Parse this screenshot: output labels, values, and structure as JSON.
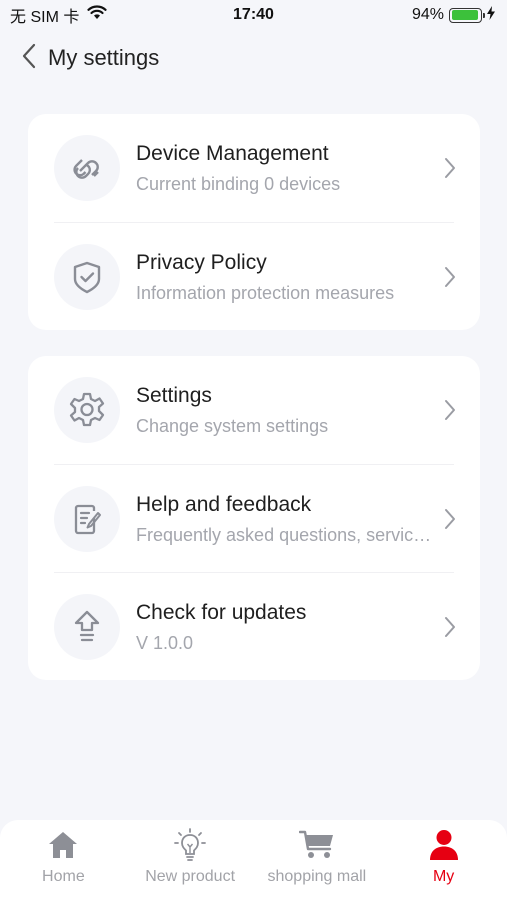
{
  "status_bar": {
    "carrier": "无 SIM 卡",
    "time": "17:40",
    "battery_percent": "94%",
    "battery_level": 0.94
  },
  "header": {
    "title": "My settings",
    "back_icon": "chevron-left-icon"
  },
  "groups": [
    {
      "items": [
        {
          "title": "Device Management",
          "subtitle": "Current binding 0 devices",
          "icon": "link-icon"
        },
        {
          "title": "Privacy Policy",
          "subtitle": "Information protection measures",
          "icon": "shield-check-icon"
        }
      ]
    },
    {
      "items": [
        {
          "title": "Settings",
          "subtitle": "Change system settings",
          "icon": "gear-icon"
        },
        {
          "title": "Help and feedback",
          "subtitle": "Frequently asked questions, service feedback",
          "icon": "edit-document-icon"
        },
        {
          "title": "Check for updates",
          "subtitle": "V 1.0.0",
          "icon": "upload-arrow-icon"
        }
      ]
    }
  ],
  "tab_bar": {
    "tabs": [
      {
        "label": "Home",
        "icon": "home-icon",
        "active": false
      },
      {
        "label": "New product",
        "icon": "lightbulb-icon",
        "active": false
      },
      {
        "label": "shopping mall",
        "icon": "cart-icon",
        "active": false
      },
      {
        "label": "My",
        "icon": "person-icon",
        "active": true
      }
    ]
  },
  "colors": {
    "accent": "#e60012",
    "background": "#f5f6fa",
    "inactive_tab": "#a2a3a8",
    "battery": "#3cc13b"
  }
}
